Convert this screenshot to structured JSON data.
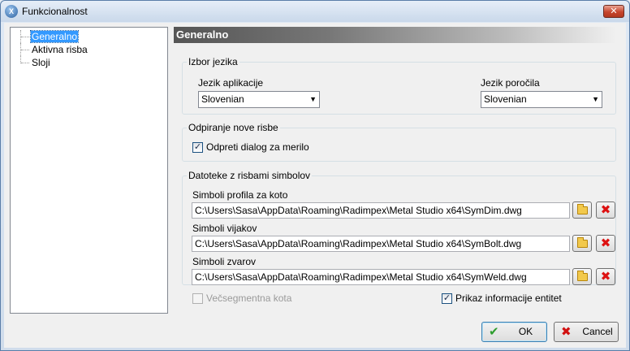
{
  "window": {
    "title": "Funkcionalnost",
    "icon_text": "X",
    "close_symbol": "✕"
  },
  "tree": {
    "items": [
      {
        "label": "Generalno",
        "selected": true
      },
      {
        "label": "Aktivna risba",
        "selected": false
      },
      {
        "label": "Sloji",
        "selected": false
      }
    ]
  },
  "content": {
    "header": "Generalno",
    "language_group": {
      "title": "Izbor jezika",
      "app_language_label": "Jezik aplikacije",
      "app_language_value": "Slovenian",
      "report_language_label": "Jezik poročila",
      "report_language_value": "Slovenian",
      "arrow": "▼"
    },
    "open_group": {
      "title": "Odpiranje nove risbe",
      "checkbox_label": "Odpreti dialog za merilo",
      "checked": true
    },
    "files_group": {
      "title": "Datoteke z risbami simbolov",
      "rows": [
        {
          "label": "Simboli profila za koto",
          "path": "C:\\Users\\Sasa\\AppData\\Roaming\\Radimpex\\Metal Studio x64\\SymDim.dwg"
        },
        {
          "label": "Simboli vijakov",
          "path": "C:\\Users\\Sasa\\AppData\\Roaming\\Radimpex\\Metal Studio x64\\SymBolt.dwg"
        },
        {
          "label": "Simboli zvarov",
          "path": "C:\\Users\\Sasa\\AppData\\Roaming\\Radimpex\\Metal Studio x64\\SymWeld.dwg"
        }
      ],
      "delete_symbol": "✖"
    },
    "multi_segment": {
      "label": "Večsegmentna kota",
      "checked": false,
      "enabled": false
    },
    "entity_info": {
      "label": "Prikaz informacije entitet",
      "checked": true
    },
    "check_mark": "✓"
  },
  "buttons": {
    "ok": {
      "label": "OK",
      "icon": "✔"
    },
    "cancel": {
      "label": "Cancel",
      "icon": "✖"
    }
  },
  "colors": {
    "accent": "#3399ff",
    "ok_icon": "#2e9e2e",
    "delete_icon": "#d11111"
  }
}
